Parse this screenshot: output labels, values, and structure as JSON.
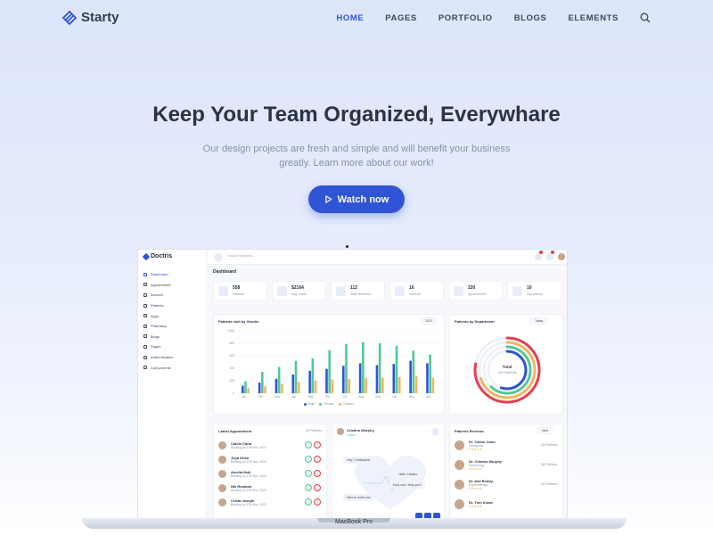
{
  "nav": {
    "logo_text": "Starty",
    "items": [
      {
        "label": "HOME",
        "active": true
      },
      {
        "label": "PAGES"
      },
      {
        "label": "PORTFOLIO"
      },
      {
        "label": "BLOGS"
      },
      {
        "label": "ELEMENTS"
      }
    ],
    "search_icon": "search-icon"
  },
  "hero": {
    "title": "Keep Your Team Organized, Everywhare",
    "subtitle_line1": "Our design projects are fresh and simple and will benefit your business",
    "subtitle_line2": "greatly. Learn more about our work!",
    "cta_label": "Watch now",
    "cta_icon": "play-icon"
  },
  "device": {
    "label": "MacBook Pro"
  },
  "dashboard": {
    "brand": "Doctris",
    "search_placeholder": "Search Keywords...",
    "sidebar": [
      {
        "label": "Dashboard",
        "active": true
      },
      {
        "label": "Appointment"
      },
      {
        "label": "Doctors"
      },
      {
        "label": "Patients"
      },
      {
        "label": "Apps"
      },
      {
        "label": "Pharmacy"
      },
      {
        "label": "Blogs"
      },
      {
        "label": "Pages"
      },
      {
        "label": "Authentication"
      },
      {
        "label": "Components"
      }
    ],
    "page_title": "Dashboard",
    "stats": [
      {
        "value": "558",
        "label": "Patients"
      },
      {
        "value": "$2164",
        "label": "Avg. costs"
      },
      {
        "value": "112",
        "label": "Staff Members"
      },
      {
        "value": "16",
        "label": "Vehicles"
      },
      {
        "value": "220",
        "label": "Appointment"
      },
      {
        "value": "10",
        "label": "Operations"
      }
    ],
    "gender_card": {
      "title": "Patients visit by Gender",
      "year": "2020"
    },
    "department_card": {
      "title": "Patients by Department",
      "range": "Today",
      "center_title": "Total",
      "center_value": "265 Patients"
    },
    "appointments": {
      "title": "Latest Appointment",
      "count": "55 Patients",
      "rows": [
        {
          "name": "Calvin Carlo",
          "info": "Booking on 27th Nov, 2020"
        },
        {
          "name": "Joya Khan",
          "info": "Booking on 27th Nov, 2020"
        },
        {
          "name": "Amelia Muli",
          "info": "Booking on 27th Nov, 2020"
        },
        {
          "name": "Nik Ronaldo",
          "info": "Booking on 27th Nov, 2020"
        },
        {
          "name": "Crista Joseph",
          "info": "Booking on 27th Nov, 2020"
        }
      ]
    },
    "chat": {
      "name": "Cristino Murphy",
      "status": "Online",
      "messages": [
        "Hey, Christopher",
        "Hello Cristino",
        "How can i help you?",
        "Nice to meet you"
      ]
    },
    "reviews": {
      "title": "Patients Reviews",
      "filter": "New",
      "rows": [
        {
          "name": "Dr. Calvin Carlo",
          "dept": "Orthopedic",
          "count": "150 Patients"
        },
        {
          "name": "Dr. Cristino Murphy",
          "dept": "Gynecology",
          "count": "150 Patients"
        },
        {
          "name": "Dr. Alia Reddy",
          "dept": "Psychotherapy",
          "count": "150 Patients"
        },
        {
          "name": "Dr. Toni Kovar",
          "dept": "",
          "count": ""
        }
      ]
    }
  },
  "chart_data": [
    {
      "type": "bar",
      "title": "Patients visit by Gender",
      "categories": [
        "Jan",
        "Feb",
        "Mar",
        "Apr",
        "May",
        "Jun",
        "Jul",
        "Aug",
        "Sep",
        "Oct",
        "Nov",
        "Dec"
      ],
      "ylim": [
        0,
        1000
      ],
      "yticks": [
        "1000",
        "800",
        "600",
        "400",
        "200",
        "0"
      ],
      "series": [
        {
          "name": "Male",
          "color": "#2f55d4",
          "values": [
            120,
            170,
            230,
            300,
            360,
            390,
            440,
            480,
            450,
            470,
            520,
            480
          ]
        },
        {
          "name": "Female",
          "color": "#53c797",
          "values": [
            190,
            340,
            420,
            520,
            560,
            690,
            790,
            820,
            800,
            760,
            680,
            620
          ]
        },
        {
          "name": "Children",
          "color": "#f1b561",
          "values": [
            80,
            110,
            150,
            180,
            200,
            220,
            230,
            240,
            250,
            260,
            270,
            250
          ]
        }
      ]
    },
    {
      "type": "radial-bar",
      "title": "Patients by Department",
      "values": [
        78,
        70,
        62,
        55
      ],
      "colors": [
        "#e43f52",
        "#f1b561",
        "#53c797",
        "#2f55d4"
      ]
    }
  ]
}
